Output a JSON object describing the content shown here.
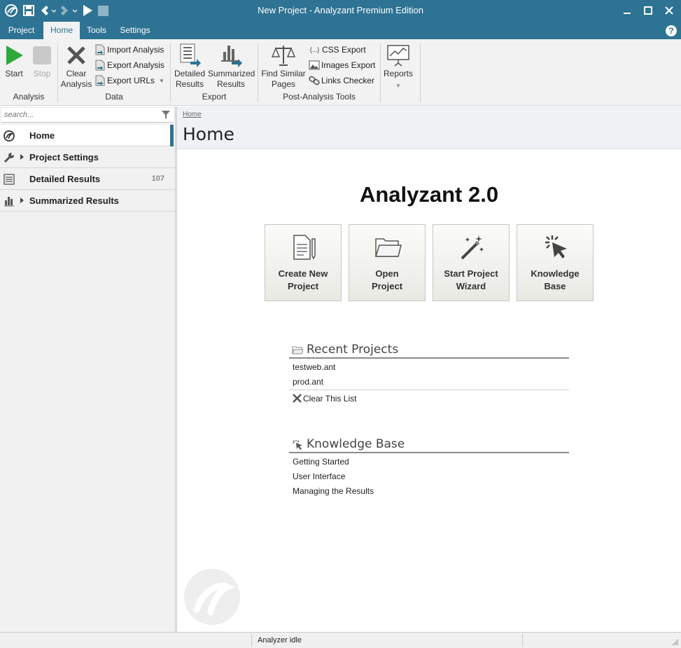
{
  "window": {
    "title": "New Project - Analyzant Premium Edition",
    "accent": "#2e7393"
  },
  "quick_access": [
    "logo-icon",
    "save-icon",
    "back-icon",
    "forward-icon",
    "play-icon",
    "stop-icon"
  ],
  "menu": {
    "tabs": [
      "Project",
      "Home",
      "Tools",
      "Settings"
    ],
    "active_tab": "Home",
    "help": "?"
  },
  "ribbon": {
    "start": "Start",
    "stop": "Stop",
    "clear_analysis": "Clear\nAnalysis",
    "import_analysis": "Import Analysis",
    "export_analysis": "Export Analysis",
    "export_urls": "Export URLs",
    "detailed_results": "Detailed\nResults",
    "summarized_results": "Summarized\nResults",
    "find_similar_pages": "Find Similar\nPages",
    "css_export": "CSS Export",
    "images_export": "Images Export",
    "links_checker": "Links Checker",
    "reports": "Reports",
    "groups": {
      "analysis": "Analysis",
      "data": "Data",
      "export": "Export",
      "post_analysis": "Post-Analysis Tools"
    }
  },
  "sidebar": {
    "search_placeholder": "search...",
    "items": [
      {
        "label": "Home",
        "icon": "logo-icon",
        "active": true
      },
      {
        "label": "Project Settings",
        "icon": "wrench-icon",
        "expandable": true
      },
      {
        "label": "Detailed Results",
        "icon": "list-icon",
        "count": "107"
      },
      {
        "label": "Summarized Results",
        "icon": "bar-chart-icon",
        "expandable": true
      }
    ]
  },
  "content": {
    "breadcrumb": "Home",
    "page_title": "Home",
    "app_title": "Analyzant 2.0",
    "tiles": [
      {
        "label": "Create New\nProject",
        "icon": "new-document-icon"
      },
      {
        "label": "Open\nProject",
        "icon": "folder-icon"
      },
      {
        "label": "Start Project\nWizard",
        "icon": "magic-wand-icon"
      },
      {
        "label": "Knowledge\nBase",
        "icon": "cursor-click-icon"
      }
    ],
    "recent": {
      "title": "Recent Projects",
      "items": [
        "testweb.ant",
        "prod.ant"
      ],
      "clear": "Clear This List"
    },
    "knowledge": {
      "title": "Knowledge Base",
      "items": [
        "Getting Started",
        "User Interface",
        "Managing the Results"
      ]
    }
  },
  "status": {
    "text": "Analyzer idle"
  }
}
